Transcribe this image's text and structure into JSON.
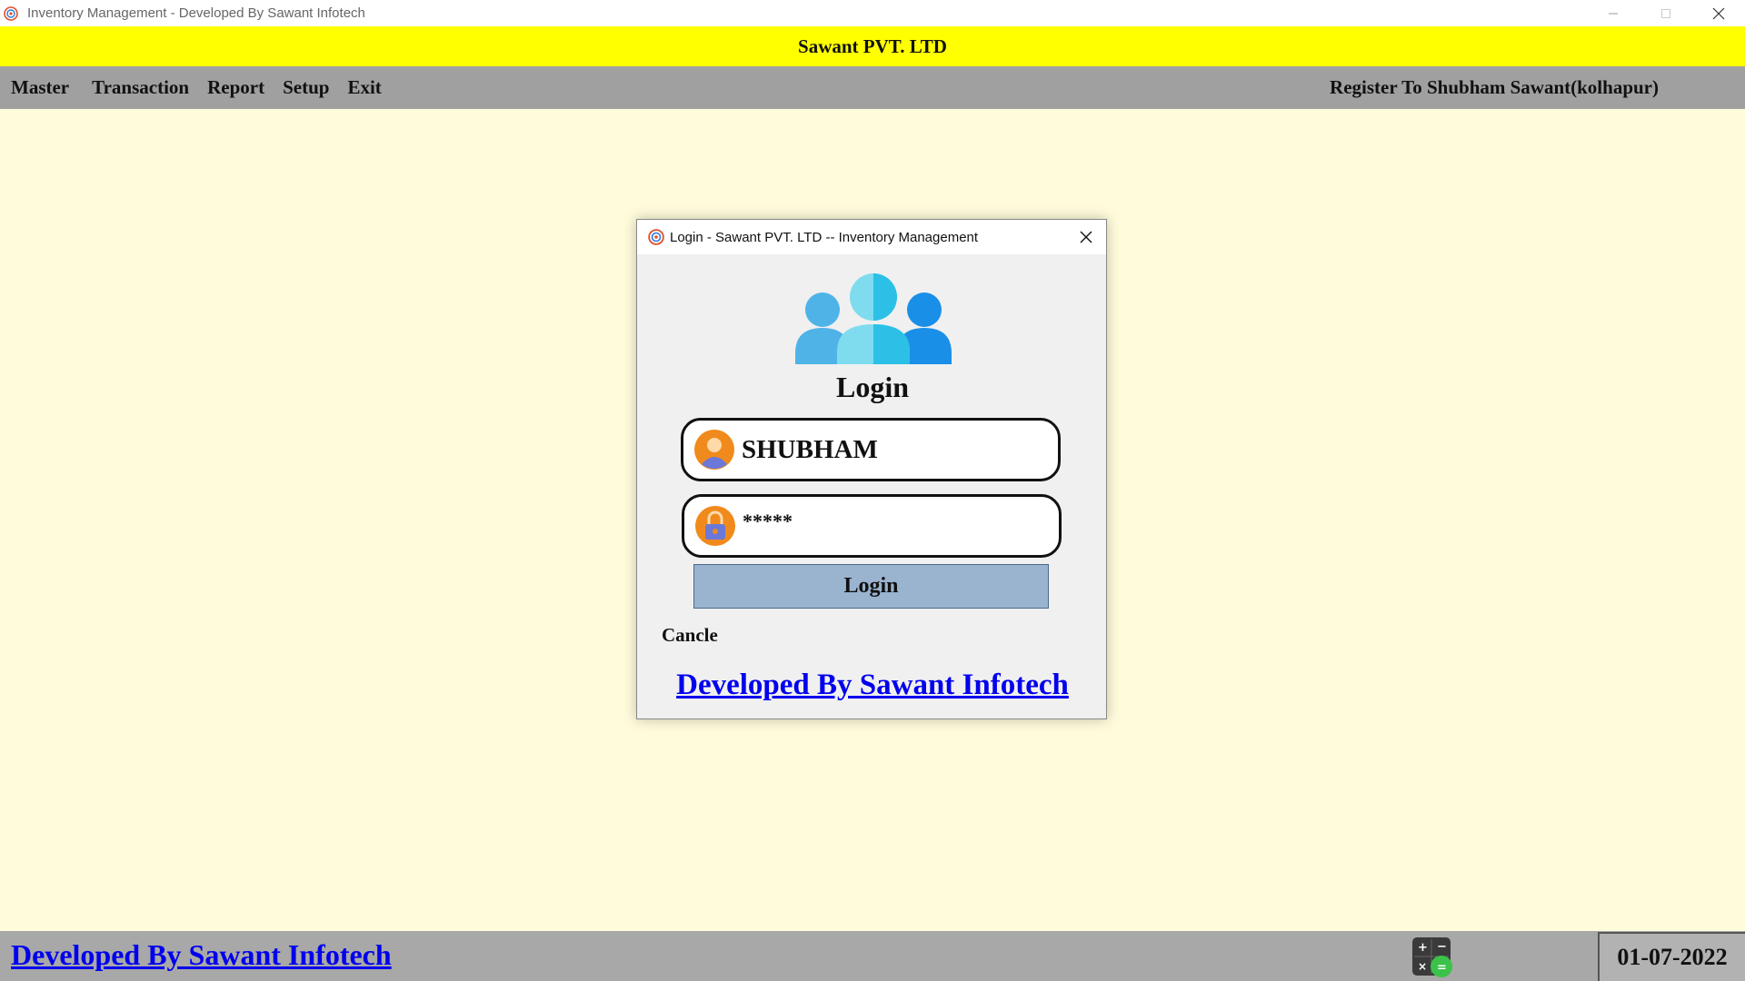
{
  "window": {
    "title": "Inventory Management - Developed By Sawant Infotech",
    "app_icon": "target-icon",
    "controls": [
      "minimize-icon",
      "maximize-icon",
      "close-icon"
    ]
  },
  "banner": {
    "company": "Sawant PVT. LTD"
  },
  "menu": {
    "items": [
      {
        "label": "Master"
      },
      {
        "label": "Transaction"
      },
      {
        "label": "Report"
      },
      {
        "label": "Setup"
      },
      {
        "label": "Exit"
      }
    ],
    "register_text": "Register To Shubham Sawant(kolhapur)"
  },
  "dialog": {
    "title": "Login -  Sawant PVT. LTD -- Inventory Management",
    "heading": "Login",
    "username": {
      "value": "SHUBHAM",
      "icon": "user-avatar-icon"
    },
    "password": {
      "value": "*****",
      "icon": "lock-icon"
    },
    "login_label": "Login",
    "cancel_label": "Cancle",
    "developer_link": "Developed By Sawant Infotech"
  },
  "status": {
    "developer_link": "Developed By Sawant Infotech",
    "calculator_icon": "calculator-icon",
    "date": "01-07-2022"
  },
  "colors": {
    "background": "#fffcdc",
    "banner": "#ffff00",
    "menubar": "#a0a0a0",
    "statusbar": "#a8a8a8",
    "link": "#0000ee",
    "login_button": "#9ab3cf"
  }
}
